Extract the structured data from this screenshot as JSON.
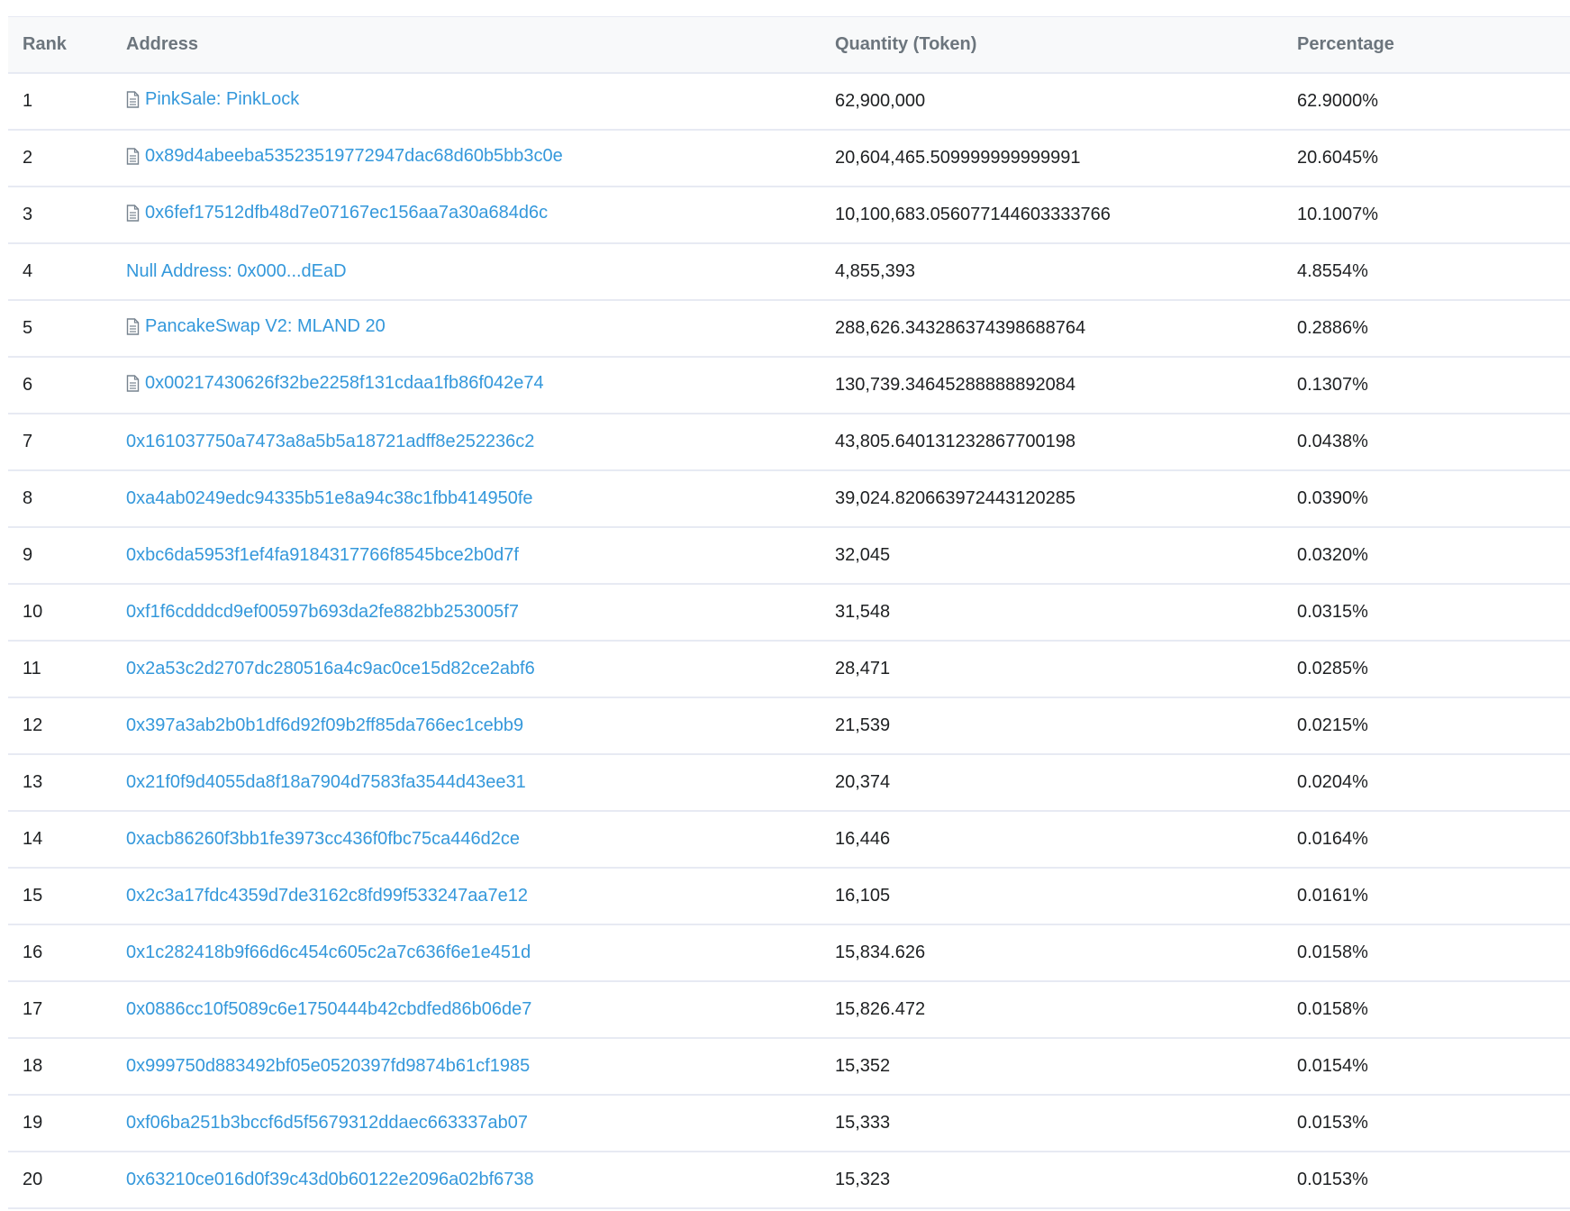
{
  "table": {
    "headers": {
      "rank": "Rank",
      "address": "Address",
      "quantity": "Quantity (Token)",
      "percentage": "Percentage"
    },
    "rows": [
      {
        "rank": "1",
        "address": "PinkSale: PinkLock",
        "contract": true,
        "quantity": "62,900,000",
        "percentage": "62.9000%"
      },
      {
        "rank": "2",
        "address": "0x89d4abeeba53523519772947dac68d60b5bb3c0e",
        "contract": true,
        "quantity": "20,604,465.509999999999991",
        "percentage": "20.6045%"
      },
      {
        "rank": "3",
        "address": "0x6fef17512dfb48d7e07167ec156aa7a30a684d6c",
        "contract": true,
        "quantity": "10,100,683.056077144603333766",
        "percentage": "10.1007%"
      },
      {
        "rank": "4",
        "address": "Null Address: 0x000...dEaD",
        "contract": false,
        "quantity": "4,855,393",
        "percentage": "4.8554%"
      },
      {
        "rank": "5",
        "address": "PancakeSwap V2: MLAND 20",
        "contract": true,
        "quantity": "288,626.343286374398688764",
        "percentage": "0.2886%"
      },
      {
        "rank": "6",
        "address": "0x00217430626f32be2258f131cdaa1fb86f042e74",
        "contract": true,
        "quantity": "130,739.34645288888892084",
        "percentage": "0.1307%"
      },
      {
        "rank": "7",
        "address": "0x161037750a7473a8a5b5a18721adff8e252236c2",
        "contract": false,
        "quantity": "43,805.640131232867700198",
        "percentage": "0.0438%"
      },
      {
        "rank": "8",
        "address": "0xa4ab0249edc94335b51e8a94c38c1fbb414950fe",
        "contract": false,
        "quantity": "39,024.820663972443120285",
        "percentage": "0.0390%"
      },
      {
        "rank": "9",
        "address": "0xbc6da5953f1ef4fa9184317766f8545bce2b0d7f",
        "contract": false,
        "quantity": "32,045",
        "percentage": "0.0320%"
      },
      {
        "rank": "10",
        "address": "0xf1f6cdddcd9ef00597b693da2fe882bb253005f7",
        "contract": false,
        "quantity": "31,548",
        "percentage": "0.0315%"
      },
      {
        "rank": "11",
        "address": "0x2a53c2d2707dc280516a4c9ac0ce15d82ce2abf6",
        "contract": false,
        "quantity": "28,471",
        "percentage": "0.0285%"
      },
      {
        "rank": "12",
        "address": "0x397a3ab2b0b1df6d92f09b2ff85da766ec1cebb9",
        "contract": false,
        "quantity": "21,539",
        "percentage": "0.0215%"
      },
      {
        "rank": "13",
        "address": "0x21f0f9d4055da8f18a7904d7583fa3544d43ee31",
        "contract": false,
        "quantity": "20,374",
        "percentage": "0.0204%"
      },
      {
        "rank": "14",
        "address": "0xacb86260f3bb1fe3973cc436f0fbc75ca446d2ce",
        "contract": false,
        "quantity": "16,446",
        "percentage": "0.0164%"
      },
      {
        "rank": "15",
        "address": "0x2c3a17fdc4359d7de3162c8fd99f533247aa7e12",
        "contract": false,
        "quantity": "16,105",
        "percentage": "0.0161%"
      },
      {
        "rank": "16",
        "address": "0x1c282418b9f66d6c454c605c2a7c636f6e1e451d",
        "contract": false,
        "quantity": "15,834.626",
        "percentage": "0.0158%"
      },
      {
        "rank": "17",
        "address": "0x0886cc10f5089c6e1750444b42cbdfed86b06de7",
        "contract": false,
        "quantity": "15,826.472",
        "percentage": "0.0158%"
      },
      {
        "rank": "18",
        "address": "0x999750d883492bf05e0520397fd9874b61cf1985",
        "contract": false,
        "quantity": "15,352",
        "percentage": "0.0154%"
      },
      {
        "rank": "19",
        "address": "0xf06ba251b3bccf6d5f5679312ddaec663337ab07",
        "contract": false,
        "quantity": "15,333",
        "percentage": "0.0153%"
      },
      {
        "rank": "20",
        "address": "0x63210ce016d0f39c43d0b60122e2096a02bf6738",
        "contract": false,
        "quantity": "15,323",
        "percentage": "0.0153%"
      }
    ]
  },
  "colors": {
    "link": "#3498db",
    "header_text": "#6c757d",
    "body_text": "#1e2022",
    "divider": "#e7eaf3",
    "header_bg": "#f8f9fa"
  },
  "icons": {
    "contract": "file-text-icon"
  }
}
